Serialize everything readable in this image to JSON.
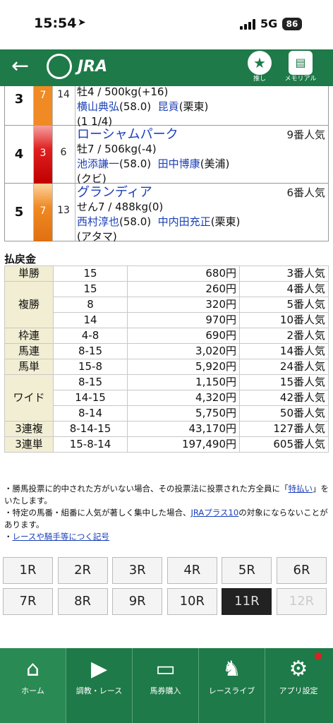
{
  "status": {
    "time": "15:54",
    "network": "5G",
    "battery": "86"
  },
  "appbar": {
    "back": "←",
    "logo": "JRA",
    "fav_label": "推し",
    "memorial_label": "メモリアル"
  },
  "runners": [
    {
      "pos": "3",
      "waku": "7",
      "uma": "14",
      "color": "#f08a24",
      "name": "",
      "popular": "",
      "line1": "牡4 / 500kg(+16)",
      "jockey": "横山典弘",
      "jockey_weight": "(58.0)",
      "trainer": "昆貢",
      "stable": "(栗東)",
      "note": "(1 1/4)"
    },
    {
      "pos": "4",
      "waku": "3",
      "uma": "6",
      "color": "#e02020",
      "name": "ローシャムパーク",
      "popular": "9番人気",
      "line1": "牡7 / 506kg(-4)",
      "jockey": "池添謙一",
      "jockey_weight": "(58.0)",
      "trainer": "田中博康",
      "stable": "(美浦)",
      "note": "(クビ)"
    },
    {
      "pos": "5",
      "waku": "7",
      "uma": "13",
      "color": "#f08a24",
      "name": "グランディア",
      "popular": "6番人気",
      "line1": "せん7 / 488kg(0)",
      "jockey": "西村淳也",
      "jockey_weight": "(58.0)",
      "trainer": "中内田充正",
      "stable": "(栗東)",
      "note": "(アタマ)"
    }
  ],
  "payout": {
    "title": "払戻金",
    "rows": [
      {
        "kind": "単勝",
        "entries": [
          {
            "c": "15",
            "v": "680円",
            "p": "3番人気"
          }
        ]
      },
      {
        "kind": "複勝",
        "entries": [
          {
            "c": "15",
            "v": "260円",
            "p": "4番人気"
          },
          {
            "c": "8",
            "v": "320円",
            "p": "5番人気"
          },
          {
            "c": "14",
            "v": "970円",
            "p": "10番人気"
          }
        ]
      },
      {
        "kind": "枠連",
        "entries": [
          {
            "c": "4-8",
            "v": "690円",
            "p": "2番人気"
          }
        ]
      },
      {
        "kind": "馬連",
        "entries": [
          {
            "c": "8-15",
            "v": "3,020円",
            "p": "14番人気"
          }
        ]
      },
      {
        "kind": "馬単",
        "entries": [
          {
            "c": "15-8",
            "v": "5,920円",
            "p": "24番人気"
          }
        ]
      },
      {
        "kind": "ワイド",
        "entries": [
          {
            "c": "8-15",
            "v": "1,150円",
            "p": "15番人気"
          },
          {
            "c": "14-15",
            "v": "4,320円",
            "p": "42番人気"
          },
          {
            "c": "8-14",
            "v": "5,750円",
            "p": "50番人気"
          }
        ]
      },
      {
        "kind": "3連複",
        "entries": [
          {
            "c": "8-14-15",
            "v": "43,170円",
            "p": "127番人気"
          }
        ]
      },
      {
        "kind": "3連単",
        "entries": [
          {
            "c": "15-8-14",
            "v": "197,490円",
            "p": "605番人気"
          }
        ]
      }
    ]
  },
  "notes": {
    "n1_pre": "・勝馬投票に的中された方がいない場合、その投票法に投票された方全員に「",
    "n1_link": "特払い",
    "n1_post": "」をいたします。",
    "n2_pre": "・特定の馬番・組番に人気が著しく集中した場合、",
    "n2_link": "JRAプラス10",
    "n2_post": "の対象にならないことがあります。",
    "n3_pre": "・",
    "n3_link": "レースや騎手等につく記号"
  },
  "races": [
    "1R",
    "2R",
    "3R",
    "4R",
    "5R",
    "6R",
    "7R",
    "8R",
    "9R",
    "10R",
    "11R",
    "12R"
  ],
  "races_active": "11R",
  "races_disabled": "12R",
  "tabs": [
    {
      "label": "ホーム",
      "icon": "home-icon"
    },
    {
      "label": "調教・レース",
      "icon": "video-icon"
    },
    {
      "label": "馬券購入",
      "icon": "ticket-icon"
    },
    {
      "label": "レースライブ",
      "icon": "live-horse-icon"
    },
    {
      "label": "アプリ設定",
      "icon": "gear-icon"
    }
  ]
}
